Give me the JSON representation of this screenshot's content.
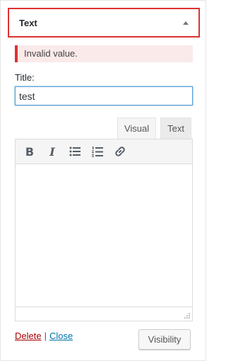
{
  "widget": {
    "title": "Text",
    "error": "Invalid value.",
    "title_label": "Title:",
    "title_value": "test",
    "tabs": {
      "visual": "Visual",
      "text": "Text"
    },
    "toolbar": {
      "bold": "B",
      "italic": "I"
    },
    "actions": {
      "delete": "Delete",
      "separator": "|",
      "close": "Close",
      "visibility": "Visibility"
    }
  },
  "colors": {
    "error": "#dc3232",
    "link": "#0073aa",
    "delete": "#a00000"
  },
  "icons": [
    "bold-icon",
    "italic-icon",
    "bulleted-list-icon",
    "numbered-list-icon",
    "link-icon",
    "toggle-arrow-icon",
    "resize-handle-icon"
  ]
}
